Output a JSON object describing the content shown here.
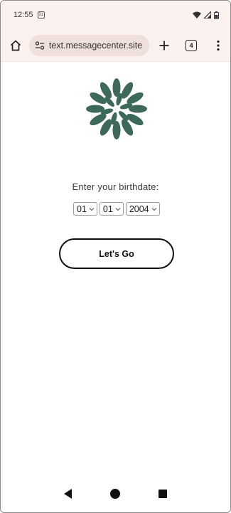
{
  "status_bar": {
    "time": "12:55",
    "calendar_day": "31"
  },
  "browser": {
    "url": "text.messagecenter.site",
    "tab_count": "4"
  },
  "form": {
    "prompt": "Enter your birthdate:",
    "month": {
      "selected": "01"
    },
    "day": {
      "selected": "01"
    },
    "year": {
      "selected": "2004"
    },
    "submit_label": "Let's Go"
  },
  "colors": {
    "chrome_bg": "#fbf1ee",
    "url_pill_bg": "#f0e0dc",
    "logo_green": "#3d6a58"
  },
  "icons": [
    "home-icon",
    "site-settings-icon",
    "plus-icon",
    "tab-switcher-icon",
    "more-vert-icon",
    "flower-logo-icon",
    "wifi-icon",
    "signal-icon",
    "battery-icon"
  ]
}
